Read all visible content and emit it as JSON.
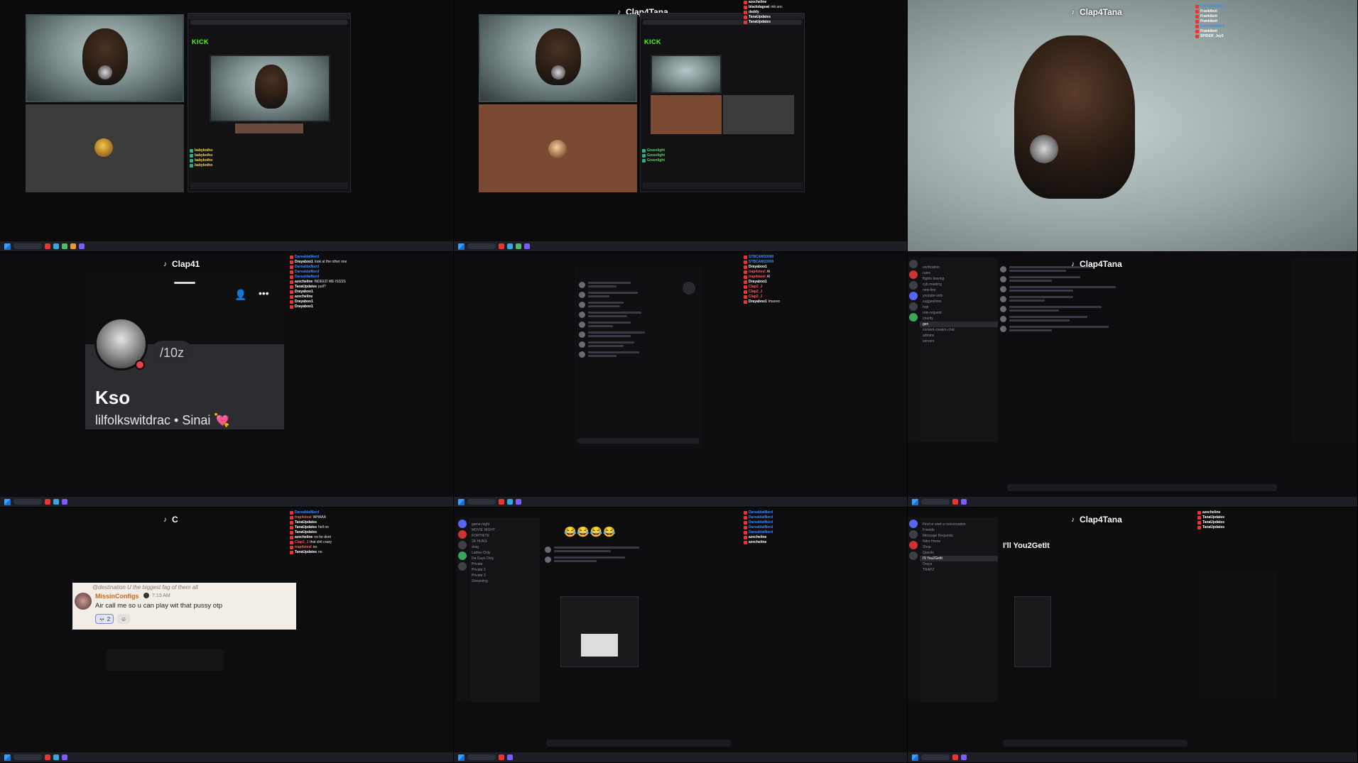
{
  "watermarks": {
    "t1": "Clap4Tana",
    "t2": "Clap4Tana",
    "r2t1": "Clap41",
    "r2t3": "Clap4Tana",
    "r3t1": "C",
    "r3t3": "Clap4Tana"
  },
  "kick": {
    "logo": "KICK"
  },
  "profile": {
    "status": "/10z",
    "name": "Kso",
    "subtitle": "lilfolkswitdrac • Sinai 💘"
  },
  "quote": {
    "reply_line": "@destination U the biggest fag of them all",
    "author": "MissinConfigs",
    "time": "7:13 AM",
    "text": "Air call me so u can play wit that pussy otp",
    "reaction_count": "2"
  },
  "dm": {
    "header": "I'll You2GetIt",
    "title": "I'll You2GetIt"
  },
  "emojis": "😂😂😂😂",
  "chat_right_1": [
    {
      "name": "DarealdatNerd",
      "color": "#3b8bff",
      "text": ""
    },
    {
      "name": "Drayaboo1",
      "color": "#ffffff",
      "text": "look at the other one"
    },
    {
      "name": "DarealdatNerd",
      "color": "#3b8bff",
      "text": ""
    },
    {
      "name": "DarealdatNerd",
      "color": "#3b8bff",
      "text": ""
    },
    {
      "name": "DarealdatNerd",
      "color": "#3b8bff",
      "text": ""
    },
    {
      "name": "azecheline",
      "color": "#ffffff",
      "text": "INDEED WE ISSSS"
    },
    {
      "name": "TanaUpdates",
      "color": "#ffffff",
      "text": "pull?"
    },
    {
      "name": "Drayaboo1",
      "color": "#ffffff",
      "text": ""
    },
    {
      "name": "azecheline",
      "color": "#ffffff",
      "text": ""
    },
    {
      "name": "Drayaboo1",
      "color": "#ffffff",
      "text": ""
    },
    {
      "name": "Drayaboo1",
      "color": "#ffffff",
      "text": ""
    }
  ],
  "chat_right_2": [
    {
      "name": "STBCAM10000",
      "color": "#3b8bff",
      "text": ""
    },
    {
      "name": "STBCAM10000",
      "color": "#3b8bff",
      "text": ""
    },
    {
      "name": "Drayaboo1",
      "color": "#ffffff",
      "text": ""
    },
    {
      "name": "trap4steel",
      "color": "#ff5a5a",
      "text": "AI"
    },
    {
      "name": "trap4steel",
      "color": "#ff5a5a",
      "text": "AI"
    },
    {
      "name": "Drayaboo1",
      "color": "#ffffff",
      "text": ""
    },
    {
      "name": "Clap2_J",
      "color": "#ff5a5a",
      "text": ""
    },
    {
      "name": "Clap2_J",
      "color": "#ff5a5a",
      "text": ""
    },
    {
      "name": "Clap2_J",
      "color": "#ff5a5a",
      "text": ""
    },
    {
      "name": "Drayaboo1",
      "color": "#ffffff",
      "text": "lmaooo"
    }
  ],
  "chat_right_3": [
    {
      "name": "DarealdatNerd",
      "color": "#3b8bff",
      "text": ""
    },
    {
      "name": "trap4steal",
      "color": "#ff5a5a",
      "text": "WHAAA"
    },
    {
      "name": "TanaUpdates",
      "color": "#ffffff",
      "text": ""
    },
    {
      "name": "TanaUpdates",
      "color": "#ffffff",
      "text": "hell no"
    },
    {
      "name": "TanaUpdates",
      "color": "#ffffff",
      "text": ""
    },
    {
      "name": "azecheline",
      "color": "#ffffff",
      "text": "no he dont"
    },
    {
      "name": "Clap2_J",
      "color": "#ff5a5a",
      "text": "that shit crazy"
    },
    {
      "name": "trap4steal",
      "color": "#ff5a5a",
      "text": "no"
    },
    {
      "name": "TanaUpdates",
      "color": "#ffffff",
      "text": "no"
    }
  ],
  "chat_top_right": [
    {
      "name": "DarealdatNerd",
      "color": "#3b8bff",
      "text": ""
    },
    {
      "name": "Frankiboii",
      "color": "#ffffff",
      "text": ""
    },
    {
      "name": "Frankiboii",
      "color": "#ffffff",
      "text": ""
    },
    {
      "name": "Frankiboii",
      "color": "#ffffff",
      "text": ""
    },
    {
      "name": "DarealdatNerd",
      "color": "#3b8bff",
      "text": ""
    },
    {
      "name": "Frankiboii",
      "color": "#ffffff",
      "text": ""
    },
    {
      "name": "SPIDER_Jay3",
      "color": "#ffffff",
      "text": ""
    }
  ],
  "chat_top_mid": [
    {
      "name": "azecheline",
      "color": "#ffffff",
      "text": ""
    },
    {
      "name": "blackdagoat",
      "color": "#ffffff",
      "text": "mb unc"
    },
    {
      "name": "daddy",
      "color": "#ffffff",
      "text": ""
    },
    {
      "name": "TanaUpdates",
      "color": "#ffffff",
      "text": ""
    },
    {
      "name": "TanaUpdates",
      "color": "#ffffff",
      "text": ""
    }
  ],
  "chat_bottom_mid": [
    {
      "name": "DarealdatNerd",
      "color": "#3b8bff",
      "text": ""
    },
    {
      "name": "DarealdatNerd",
      "color": "#3b8bff",
      "text": ""
    },
    {
      "name": "DarealdatNerd",
      "color": "#3b8bff",
      "text": ""
    },
    {
      "name": "DarealdatNerd",
      "color": "#3b8bff",
      "text": ""
    },
    {
      "name": "DarealdatNerd",
      "color": "#3b8bff",
      "text": ""
    },
    {
      "name": "azecheline",
      "color": "#ffffff",
      "text": ""
    },
    {
      "name": "azecheline",
      "color": "#ffffff",
      "text": ""
    }
  ],
  "chat_bottom_right": [
    {
      "name": "azecheline",
      "color": "#ffffff",
      "text": ""
    },
    {
      "name": "TanaUpdates",
      "color": "#ffffff",
      "text": ""
    },
    {
      "name": "TanaUpdates",
      "color": "#ffffff",
      "text": ""
    },
    {
      "name": "TanaUpdates",
      "color": "#ffffff",
      "text": ""
    }
  ]
}
